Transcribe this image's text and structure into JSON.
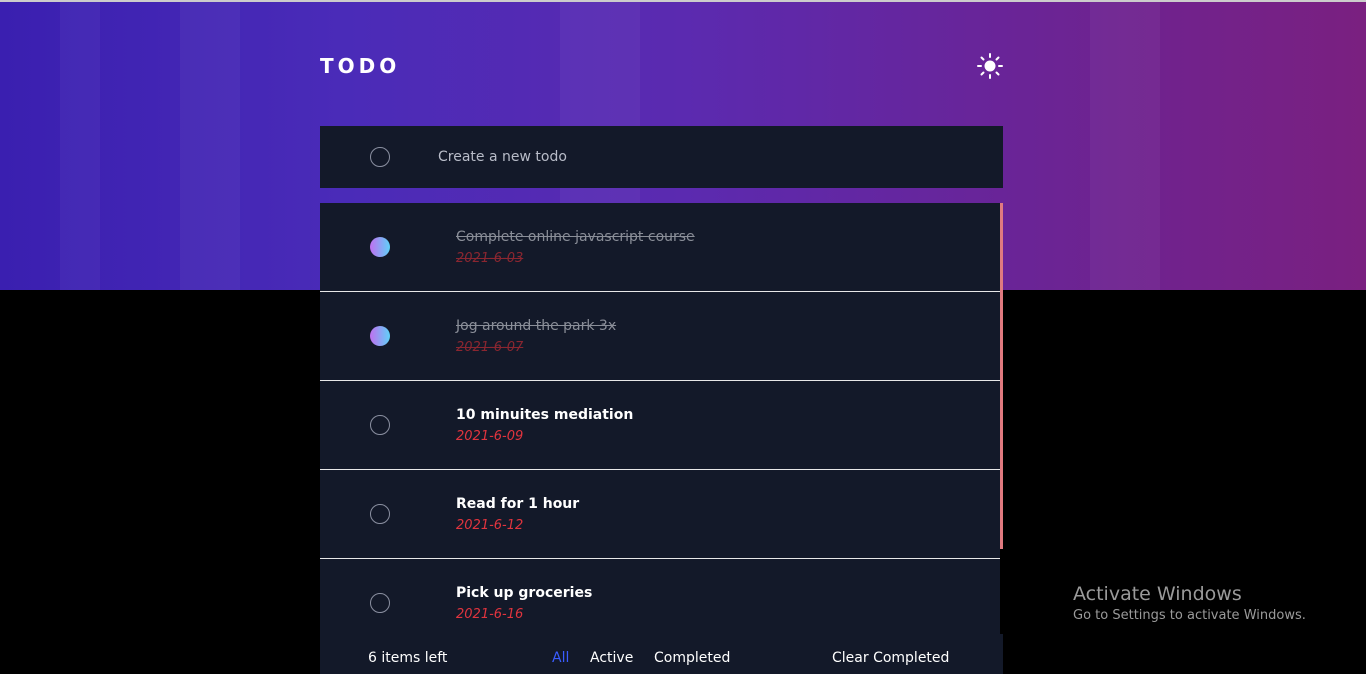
{
  "header": {
    "title": "TODO",
    "theme_icon": "sun-icon"
  },
  "new_todo": {
    "placeholder": "Create a new todo"
  },
  "colors": {
    "accent_gradient": [
      "#c070f0",
      "#60d0f8"
    ],
    "date": "#e0343e",
    "card": "#131929"
  },
  "todos": [
    {
      "title": "Complete online javascript course",
      "date": "2021-6-03",
      "completed": true
    },
    {
      "title": "Jog around the park 3x",
      "date": "2021-6-07",
      "completed": true
    },
    {
      "title": "10 minuites mediation",
      "date": "2021-6-09",
      "completed": false
    },
    {
      "title": "Read for 1 hour",
      "date": "2021-6-12",
      "completed": false
    },
    {
      "title": "Pick up groceries",
      "date": "2021-6-16",
      "completed": false
    }
  ],
  "footer": {
    "items_left": "6 items left",
    "filters": [
      "All",
      "Active",
      "Completed"
    ],
    "clear": "Clear Completed"
  },
  "watermark": {
    "title": "Activate Windows",
    "subtitle": "Go to Settings to activate Windows."
  }
}
